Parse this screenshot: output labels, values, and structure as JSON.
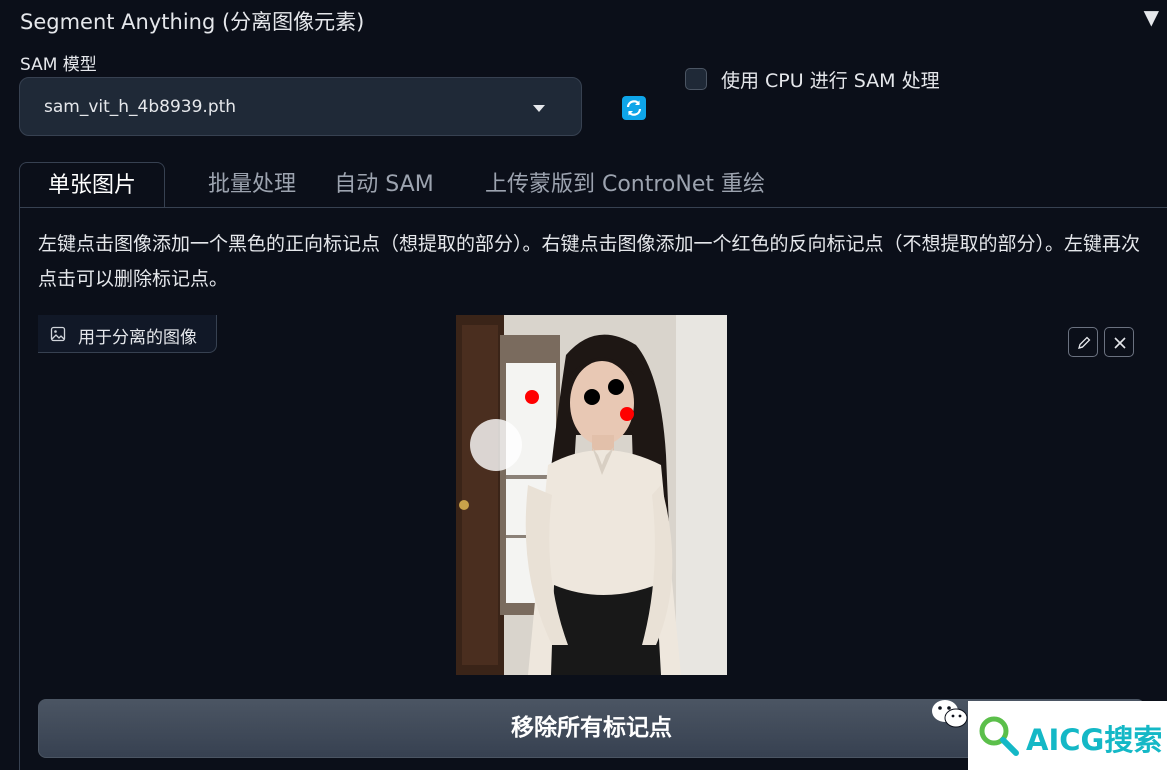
{
  "accordion": {
    "title": "Segment Anything (分离图像元素)",
    "toggle": "▼"
  },
  "model": {
    "label": "SAM 模型",
    "value": "sam_vit_h_4b8939.pth"
  },
  "cpu_option": {
    "label": "使用 CPU 进行 SAM 处理",
    "checked": false
  },
  "tabs": [
    {
      "label": "单张图片",
      "selected": true
    },
    {
      "label": "批量处理",
      "selected": false
    },
    {
      "label": "自动 SAM",
      "selected": false
    },
    {
      "label": "上传蒙版到 ControNet 重绘",
      "selected": false
    }
  ],
  "instructions": "左键点击图像添加一个黑色的正向标记点（想提取的部分）。右键点击图像添加一个红色的反向标记点（不想提取的部分）。左键再次点击可以删除标记点。",
  "image_input": {
    "label": "用于分离的图像"
  },
  "markers": {
    "positive_color": "#000000",
    "negative_color": "#ff0000"
  },
  "remove_button": {
    "label": "移除所有标记点"
  },
  "watermark": {
    "text": "AICG搜索"
  },
  "icons": {
    "refresh": "refresh-icon",
    "image": "image-icon",
    "edit": "pencil-icon",
    "clear": "close-icon",
    "wechat": "wechat-icon",
    "search": "search-icon"
  }
}
